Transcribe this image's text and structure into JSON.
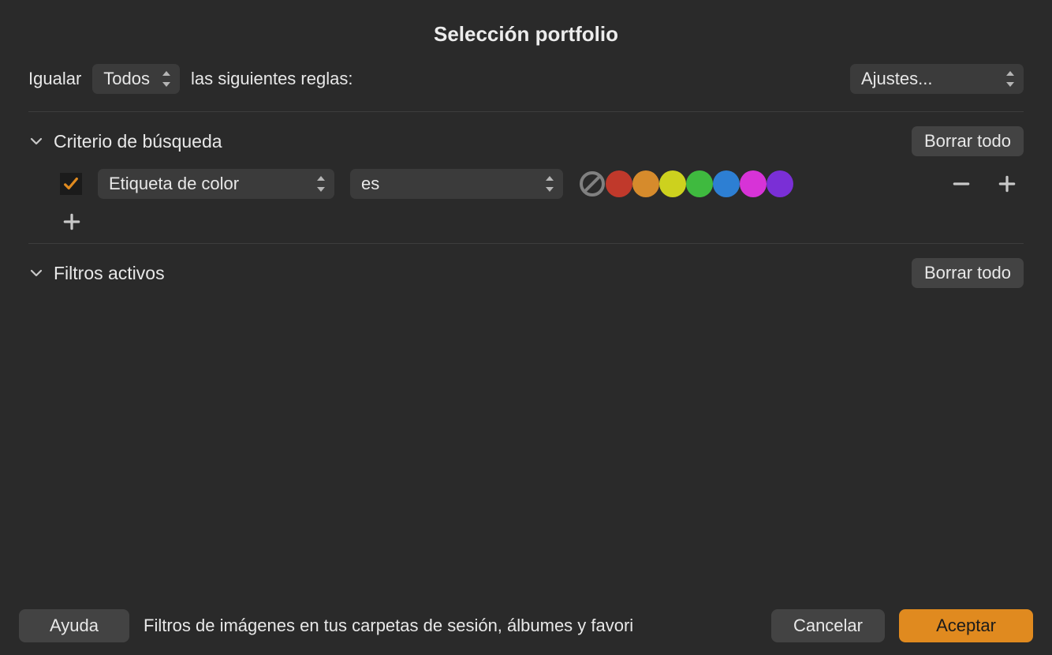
{
  "title": "Selección portfolio",
  "match_row": {
    "prefix": "Igualar",
    "mode": "Todos",
    "suffix": "las siguientes reglas:",
    "settings_label": "Ajustes..."
  },
  "sections": {
    "search": {
      "title": "Criterio de búsqueda",
      "clear_all": "Borrar todo"
    },
    "active_filters": {
      "title": "Filtros activos",
      "clear_all": "Borrar todo"
    }
  },
  "criteria": {
    "enabled": true,
    "field": "Etiqueta de color",
    "operator": "es"
  },
  "colors": {
    "none": "#808080",
    "palette": [
      "#c0392b",
      "#d68b2c",
      "#cdd11e",
      "#3fba3f",
      "#2d7fd3",
      "#d733d7",
      "#7a2fd6"
    ]
  },
  "footer": {
    "help": "Ayuda",
    "info": "Filtros de imágenes en tus carpetas de sesión, álbumes y favori",
    "cancel": "Cancelar",
    "accept": "Aceptar"
  }
}
